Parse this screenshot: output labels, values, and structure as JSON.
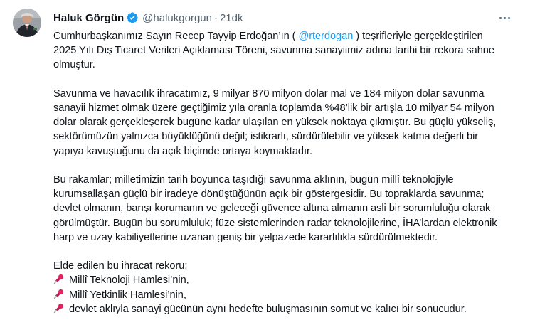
{
  "author": {
    "display_name": "Haluk Görgün",
    "handle": "@halukgorgun",
    "separator": "·",
    "time": "21dk"
  },
  "tweet": {
    "p1": {
      "l1_a": "Cumhurbaşkanımız Sayın Recep Tayyip Erdoğan’ın ( ",
      "mention": "@rterdogan",
      "l1_b": " )  teşrifleriyle gerçekleştirilen",
      "l2": "2025 Yılı Dış Ticaret Verileri Açıklaması Töreni, savunma sanayiimiz adına tarihi bir rekora sahne",
      "l3": "olmuştur."
    },
    "p2": [
      "Savunma ve havacılık ihracatımız, 9 milyar 870 milyon dolar mal ve 184 milyon dolar savunma",
      "sanayii hizmet olmak üzere  geçtiğimiz yıla oranla toplamda %48’lik bir artışla 10 milyar 54 milyon",
      "dolar olarak gerçekleşerek bugüne kadar ulaşılan en yüksek noktaya çıkmıştır. Bu güçlü yükseliş,",
      "sektörümüzün yalnızca büyüklüğünü değil; istikrarlı, sürdürülebilir ve yüksek katma değerli bir",
      "yapıya kavuştuğunu da açık biçimde ortaya koymaktadır."
    ],
    "p3": [
      "Bu rakamlar; milletimizin tarih boyunca taşıdığı savunma aklının, bugün millî teknolojiyle",
      "kurumsallaşan güçlü bir iradeye dönüştüğünün açık bir göstergesidir. Bu topraklarda savunma;",
      "devlet olmanın, barışı korumanın ve geleceği güvence altına almanın asli bir sorumluluğu olarak",
      "görülmüştür. Bugün bu sorumluluk; füze sistemlerinden radar teknolojilerine, İHA’lardan elektronik",
      "harp ve uzay kabiliyetlerine uzanan geniş bir yelpazede kararlılıkla sürdürülmektedir."
    ],
    "p4_intro": "Elde edilen bu ihracat rekoru;",
    "bullets": [
      "Millî Teknoloji Hamlesi’nin,",
      "Millî Yetkinlik Hamlesi’nin,",
      "devlet aklıyla sanayi gücünün aynı hedefte buluşmasının somut ve kalıcı bir sonucudur."
    ],
    "bullet_icon": "pushpin-icon"
  },
  "colors": {
    "text": "#0f1419",
    "secondary": "#536471",
    "link": "#1d9bf0",
    "verified": "#1d9bf0",
    "pin": "#e0245e"
  }
}
